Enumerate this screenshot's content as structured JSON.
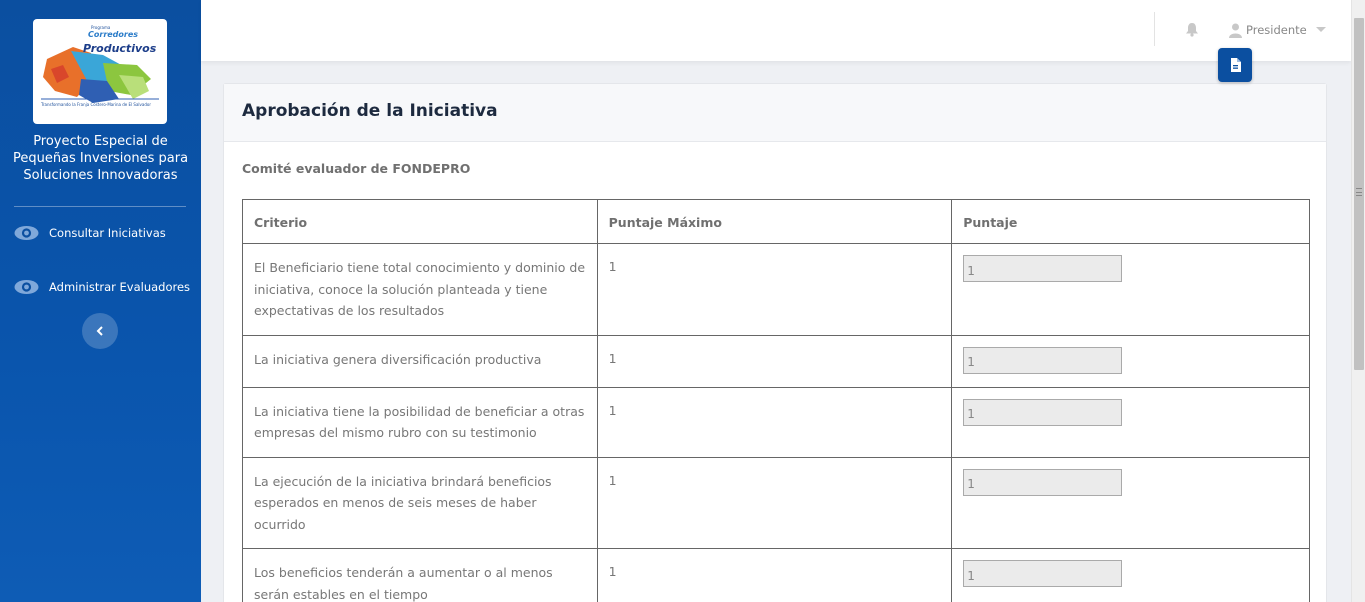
{
  "sidebar": {
    "logo": {
      "line1": "Programa",
      "line2": "Corredores",
      "line3": "Productivos",
      "tagline": "Transformando la Franja Costero-Marina de El Salvador"
    },
    "org_name": "Proyecto Especial de Pequeñas Inversiones para Soluciones Innovadoras",
    "items": [
      {
        "label": "Consultar Iniciativas",
        "icon": "eye-icon"
      },
      {
        "label": "Administrar Evaluadores",
        "icon": "eye-icon"
      }
    ],
    "collapse_icon": "chevron-left-icon"
  },
  "topbar": {
    "notifications_icon": "bell-icon",
    "user_name": "Presidente",
    "user_icon": "user-icon",
    "report_icon": "document-icon"
  },
  "card": {
    "title": "Aprobación de la Iniciativa",
    "subtitle": "Comité evaluador de FONDEPRO",
    "columns": [
      "Criterio",
      "Puntaje Máximo",
      "Puntaje"
    ],
    "rows": [
      {
        "criterio": "El Beneficiario tiene total conocimiento y dominio de iniciativa, conoce la solución planteada y tiene expectativas de los resultados",
        "max": "1",
        "score": "1"
      },
      {
        "criterio": "La iniciativa genera diversificación productiva",
        "max": "1",
        "score": "1"
      },
      {
        "criterio": "La iniciativa tiene la posibilidad de beneficiar a otras empresas del mismo rubro con su testimonio",
        "max": "1",
        "score": "1"
      },
      {
        "criterio": "La ejecución de la iniciativa brindará beneficios esperados en menos de seis meses de haber ocurrido",
        "max": "1",
        "score": "1"
      },
      {
        "criterio": "Los beneficios tenderán a aumentar o al menos serán estables en el tiempo",
        "max": "1",
        "score": "1"
      }
    ]
  },
  "colors": {
    "sidebar_bg": "#0b4fa0",
    "accent": "#0b4fa0",
    "title": "#1d2a3f"
  }
}
